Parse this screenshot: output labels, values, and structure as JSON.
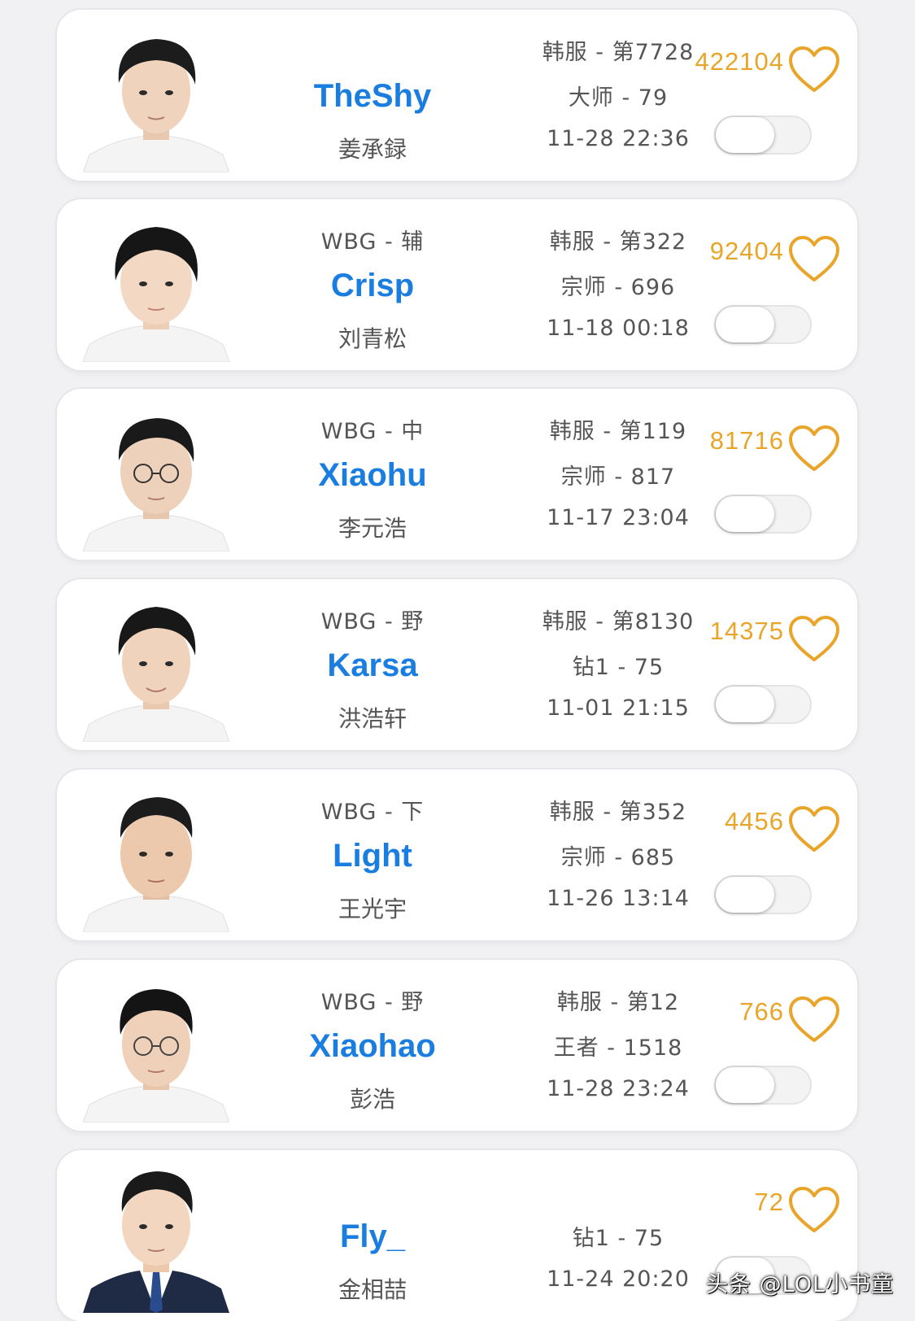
{
  "colors": {
    "page_bg": "#f1f1f3",
    "card_bg": "#ffffff",
    "name_color": "#1a7de0",
    "likes_color": "#e9a529",
    "text_color": "#555555"
  },
  "icons": {
    "heart": "heart-outline-icon",
    "toggle": "toggle-switch-off"
  },
  "players": [
    {
      "team_role": "",
      "name": "TheShy",
      "real_name": "姜承録",
      "server_rank": "韩服 - 第7728",
      "tier": "大师 - 79",
      "time": "11-28 22:36",
      "likes": "422104",
      "toggle_on": false
    },
    {
      "team_role": "WBG - 辅",
      "name": "Crisp",
      "real_name": "刘青松",
      "server_rank": "韩服 - 第322",
      "tier": "宗师 - 696",
      "time": "11-18 00:18",
      "likes": "92404",
      "toggle_on": false
    },
    {
      "team_role": "WBG - 中",
      "name": "Xiaohu",
      "real_name": "李元浩",
      "server_rank": "韩服 - 第119",
      "tier": "宗师 - 817",
      "time": "11-17 23:04",
      "likes": "81716",
      "toggle_on": false
    },
    {
      "team_role": "WBG - 野",
      "name": "Karsa",
      "real_name": "洪浩轩",
      "server_rank": "韩服 - 第8130",
      "tier": "钻1 - 75",
      "time": "11-01 21:15",
      "likes": "14375",
      "toggle_on": false
    },
    {
      "team_role": "WBG - 下",
      "name": "Light",
      "real_name": "王光宇",
      "server_rank": "韩服 - 第352",
      "tier": "宗师 - 685",
      "time": "11-26 13:14",
      "likes": "4456",
      "toggle_on": false
    },
    {
      "team_role": "WBG - 野",
      "name": "Xiaohao",
      "real_name": "彭浩",
      "server_rank": "韩服 - 第12",
      "tier": "王者 - 1518",
      "time": "11-28 23:24",
      "likes": "766",
      "toggle_on": false
    },
    {
      "team_role": "",
      "name": "Fly_",
      "real_name": "金相喆",
      "server_rank": "",
      "tier": "钻1 - 75",
      "time": "11-24 20:20",
      "likes": "72",
      "toggle_on": false
    }
  ],
  "watermark": "头条 @LOL小书童"
}
